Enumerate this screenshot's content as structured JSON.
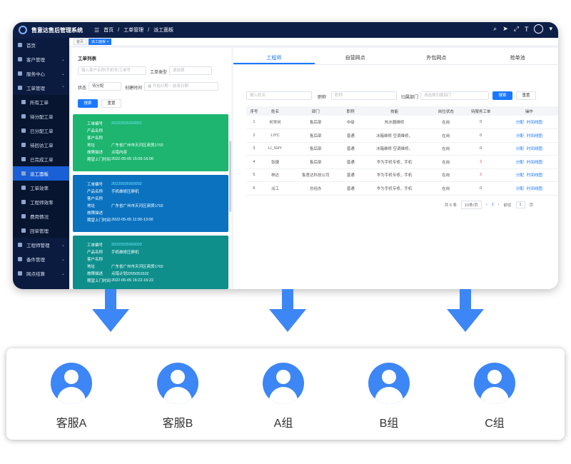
{
  "app": {
    "title": "售意达售后管理系统"
  },
  "breadcrumb": [
    "首页",
    "工单管理",
    "派工面板"
  ],
  "tags": [
    "首页",
    "派工面板"
  ],
  "sidebar": {
    "items": [
      {
        "label": "首页"
      },
      {
        "label": "客户管理"
      },
      {
        "label": "服务中心"
      },
      {
        "label": "工单管理"
      },
      {
        "label": "所有工单"
      },
      {
        "label": "待分配工单"
      },
      {
        "label": "已分配工单"
      },
      {
        "label": "待回访工单"
      },
      {
        "label": "已完成工单"
      },
      {
        "label": "派工面板"
      },
      {
        "label": "工单效率"
      },
      {
        "label": "工程师效率"
      },
      {
        "label": "费用情况"
      },
      {
        "label": "回单管理"
      },
      {
        "label": "工程师管理"
      },
      {
        "label": "备件管理"
      },
      {
        "label": "网点结算"
      }
    ]
  },
  "left": {
    "title": "工单列表",
    "search_placeholder": "输入客户名称/手机号/工单号",
    "type_label": "工单类型",
    "type_placeholder": "请选择",
    "status_label": "状态",
    "status_value": "待分配",
    "created_label": "创建时间",
    "start_placeholder": "开始日期",
    "end_placeholder": "结束日期",
    "search_btn": "搜索",
    "reset_btn": "重置",
    "cards": [
      {
        "fields": [
          {
            "k": "工单编号",
            "v": "20220505000001"
          },
          {
            "k": "产品名称",
            "v": ""
          },
          {
            "k": "客户名称",
            "v": ""
          },
          {
            "k": "地址",
            "v": "广东省广州市天河区商贸1702"
          },
          {
            "k": "故障描述",
            "v": "点错内容"
          },
          {
            "k": "期望上门时间",
            "v": "2022-05-05 15:06-16:06"
          }
        ]
      },
      {
        "fields": [
          {
            "k": "工单编号",
            "v": "20220505000002"
          },
          {
            "k": "产品名称",
            "v": "手机维修压屏机"
          },
          {
            "k": "客户名称",
            "v": ""
          },
          {
            "k": "地址",
            "v": "广东省广州市天河区商贸1702"
          },
          {
            "k": "故障描述",
            "v": ""
          },
          {
            "k": "期望上门时间",
            "v": "2022-05-05 11:00-13:00"
          }
        ]
      },
      {
        "fields": [
          {
            "k": "工单编号",
            "v": "20220505000003"
          },
          {
            "k": "产品名称",
            "v": "手机维修压屏机"
          },
          {
            "k": "客户名称",
            "v": ""
          },
          {
            "k": "地址",
            "v": "广东省广州市天河区商贸1702"
          },
          {
            "k": "故障描述",
            "v": "点错计划2205051522"
          },
          {
            "k": "期望上门时间",
            "v": "2022-05-05 16:22-16:22"
          }
        ]
      }
    ]
  },
  "right": {
    "tabs": [
      "工程师",
      "自营网点",
      "外包网点",
      "抢单池"
    ],
    "name_placeholder": "输入姓名",
    "post_label": "职称",
    "post_placeholder": "职称",
    "dept_label": "归属部门",
    "dept_placeholder": "请选择归属部门",
    "search_btn": "搜索",
    "reset_btn": "重置",
    "columns": [
      "序号",
      "姓名",
      "部门",
      "职称",
      "技能",
      "岗位状态",
      "待服务工单",
      "操作"
    ],
    "rows": [
      {
        "no": "1",
        "name": "何世何",
        "dept": "售后部",
        "title": "中级",
        "skill": "热水器维修",
        "status": "在岗",
        "pending": "0"
      },
      {
        "no": "2",
        "name": "LIYC",
        "dept": "售后部",
        "title": "普通",
        "skill": "冰箱维修 空调维修，",
        "status": "在岗",
        "pending": "0"
      },
      {
        "no": "3",
        "name": "LI_SHY",
        "dept": "售后部",
        "title": "普通",
        "skill": "冰箱维修 空调维修，",
        "status": "在岗",
        "pending": "0"
      },
      {
        "no": "4",
        "name": "张捷",
        "dept": "售后部",
        "title": "普通",
        "skill": "华为手机专修，手机",
        "status": "在岗",
        "pending": "2"
      },
      {
        "no": "5",
        "name": "林达",
        "dept": "售意达科技公司",
        "title": "普通",
        "skill": "华为手机专修，手机",
        "status": "在岗",
        "pending": "2"
      },
      {
        "no": "6",
        "name": "派工",
        "dept": "总经办",
        "title": "普通",
        "skill": "华为手机专修，手机",
        "status": "在岗",
        "pending": "0"
      }
    ],
    "op_assign": "分配",
    "op_timeline": "时间线图",
    "pager": {
      "total": "共 6 条",
      "size": "10条/页",
      "page": "1",
      "goto": "前往",
      "goto_page": "1",
      "unit": "页"
    }
  },
  "agents": [
    "客服A",
    "客服B",
    "A组",
    "B组",
    "C组"
  ],
  "colors": {
    "card1": "#1db56f",
    "card2": "#0b72bf",
    "card3": "#0e8f8c",
    "accent": "#1a78ff",
    "arrow": "#3d86f5"
  }
}
